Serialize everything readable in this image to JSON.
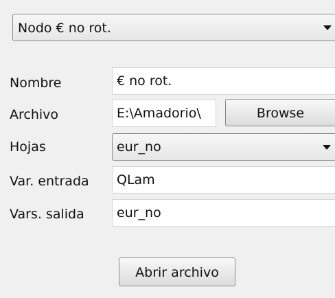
{
  "node_selector": {
    "selected": "Nodo € no rot."
  },
  "form": {
    "name": {
      "label": "Nombre",
      "value": "€ no rot."
    },
    "file": {
      "label": "Archivo",
      "value": "E:\\Amadorio\\",
      "browse_label": "Browse"
    },
    "sheets": {
      "label": "Hojas",
      "selected": "eur_no"
    },
    "input_var": {
      "label": "Var. entrada",
      "value": "QLam"
    },
    "output_vars": {
      "label": "Vars. salida",
      "value": "eur_no"
    }
  },
  "open_file_button": {
    "label": "Abrir archivo"
  },
  "icons": {
    "dropdown": "chevron-down-icon"
  },
  "colors": {
    "panel_bg": "#f0f0f0",
    "field_bg": "#ffffff",
    "border": "#8a8a8a"
  }
}
